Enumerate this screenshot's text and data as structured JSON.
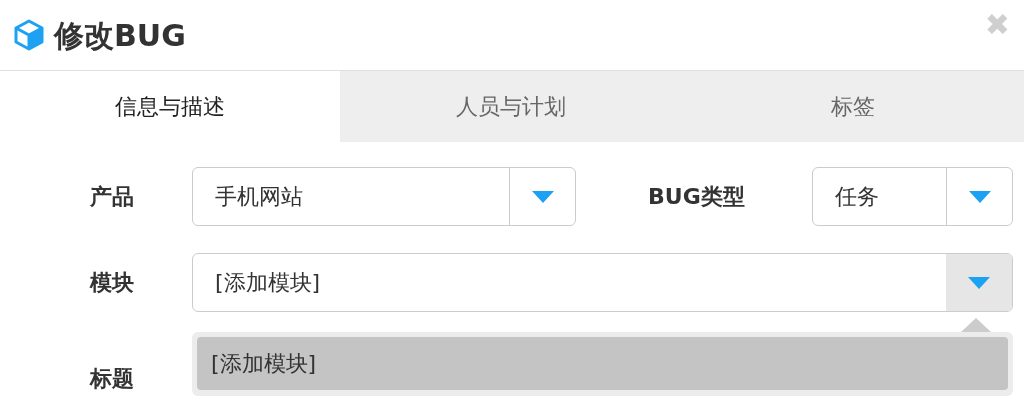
{
  "dialog": {
    "title": "修改BUG",
    "close": "✖"
  },
  "tabs": [
    {
      "label": "信息与描述",
      "selected": true
    },
    {
      "label": "人员与计划",
      "selected": false
    },
    {
      "label": "标签",
      "selected": false
    }
  ],
  "fields": {
    "product": {
      "label": "产品",
      "value": "手机网站"
    },
    "bug_type": {
      "label": "BUG类型",
      "value": "任务"
    },
    "module": {
      "label": "模块",
      "value": "[添加模块]",
      "expanded": true,
      "options": [
        {
          "label": "[添加模块]",
          "selected": true
        }
      ]
    },
    "title": {
      "label": "标题"
    }
  }
}
